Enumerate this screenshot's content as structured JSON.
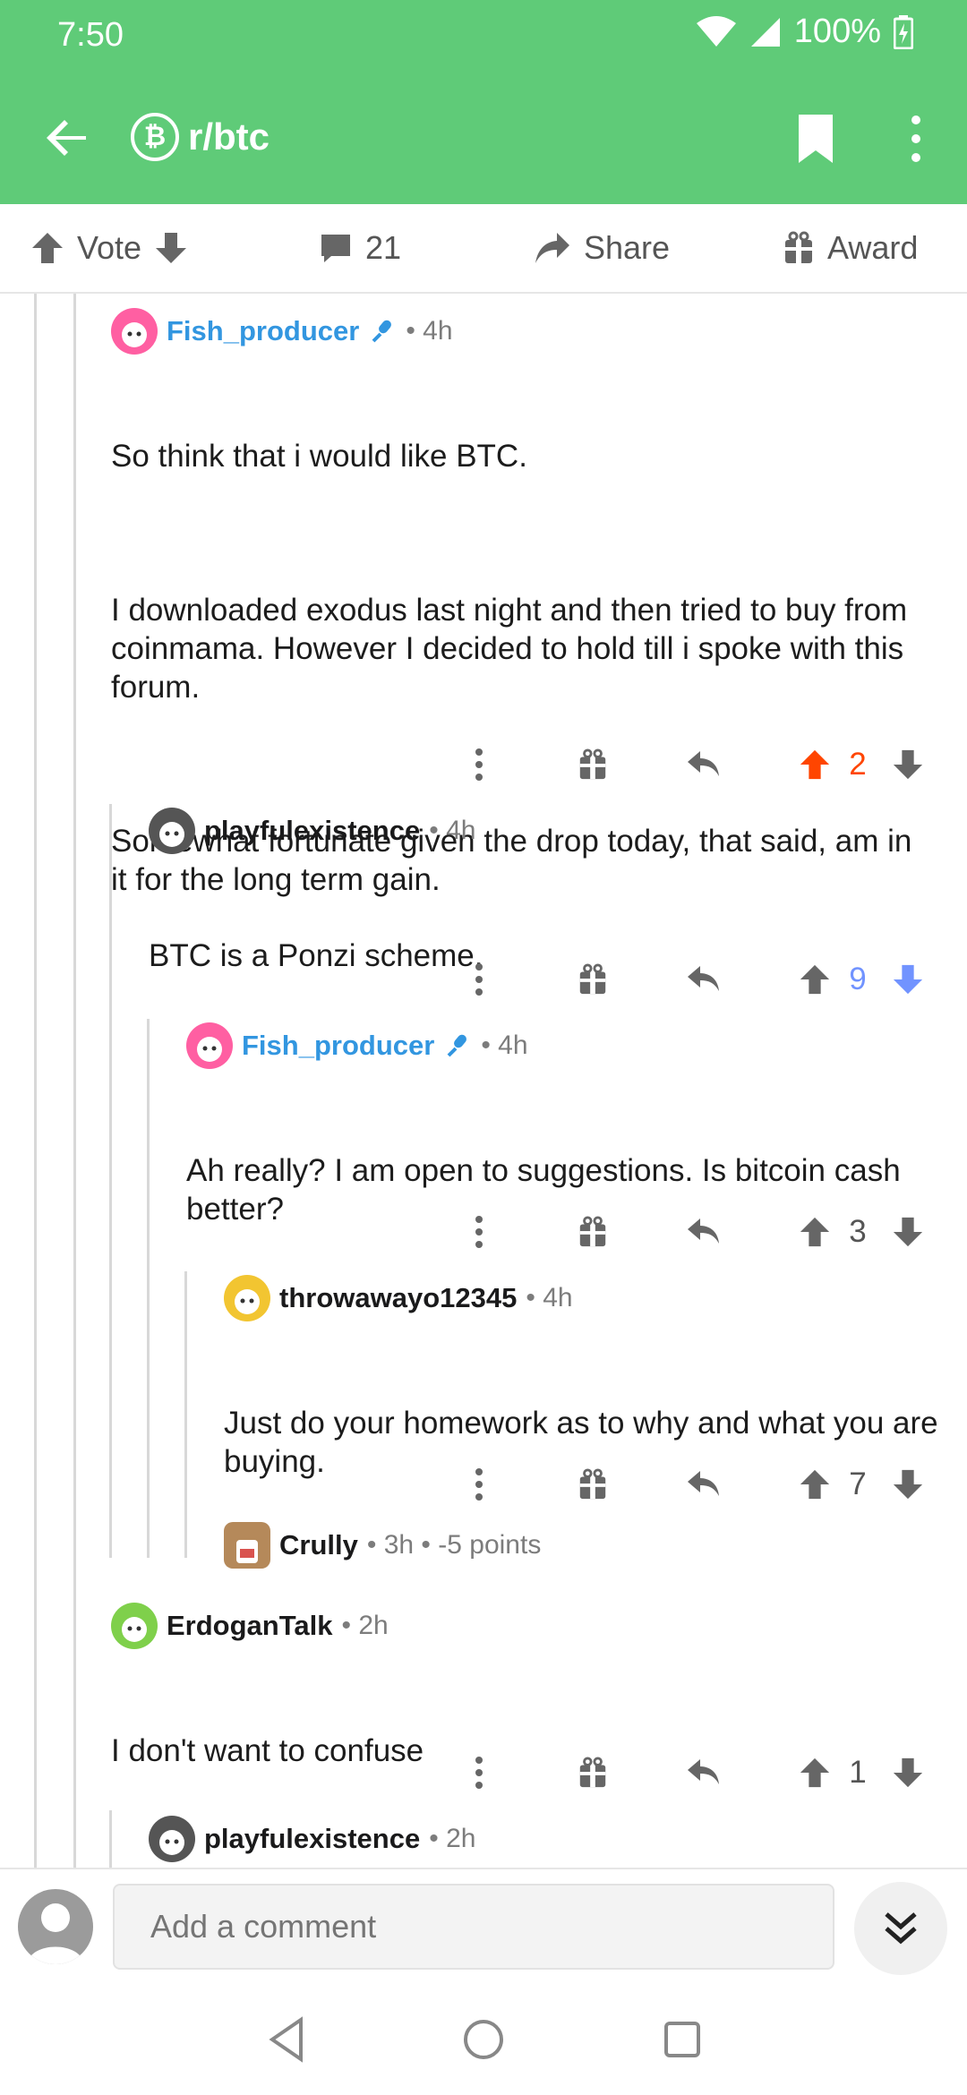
{
  "status_bar": {
    "time": "7:50",
    "battery": "100%"
  },
  "app_bar": {
    "subreddit": "r/btc",
    "subreddit_icon": "bitcoin-icon",
    "back_icon": "arrow-left-icon",
    "bookmark_icon": "bookmark-icon",
    "more_icon": "more-vertical-icon"
  },
  "action_bar": {
    "vote_label": "Vote",
    "comment_count": "21",
    "share_label": "Share",
    "award_label": "Award"
  },
  "comments": [
    {
      "username": "Fish_producer",
      "is_op": true,
      "time": "4h",
      "paragraphs": [
        "So think that i would like BTC.",
        "I downloaded exodus last night and then tried to buy from coinmama. However I decided to hold till i spoke with this forum.",
        "Somewhat fortunate given the drop today, that said, am in it for the long term gain."
      ],
      "score": "2",
      "vote_state": "up",
      "avatar_color": "#ff5fa2"
    },
    {
      "username": "playfulexistence",
      "is_op": false,
      "time": "4h",
      "paragraphs": [
        "BTC is a Ponzi scheme."
      ],
      "score": "9",
      "vote_state": "down",
      "avatar_color": "#555555"
    },
    {
      "username": "Fish_producer",
      "is_op": true,
      "time": "4h",
      "paragraphs": [
        "Ah really? I am open to suggestions. Is bitcoin cash better?"
      ],
      "score": "3",
      "vote_state": "none",
      "avatar_color": "#ff5fa2"
    },
    {
      "username": "throwawayo12345",
      "is_op": false,
      "time": "4h",
      "paragraphs": [
        "Just do your homework as to why and what you are buying."
      ],
      "score": "7",
      "vote_state": "none",
      "avatar_color": "#f2c531"
    },
    {
      "username": "Crully",
      "is_op": false,
      "time": "3h",
      "points": "-5 points",
      "avatar_color": "#b5895a"
    },
    {
      "username": "ErdoganTalk",
      "is_op": false,
      "time": "2h",
      "paragraphs": [
        "I don't want to confuse"
      ],
      "score": "1",
      "vote_state": "none",
      "avatar_color": "#7fd04b"
    },
    {
      "username": "playfulexistence",
      "is_op": false,
      "time": "2h",
      "avatar_color": "#555555"
    }
  ],
  "composer": {
    "placeholder": "Add a comment"
  },
  "colors": {
    "accent": "#5fcb78",
    "upvote": "#ff4500",
    "downvote": "#7193ff",
    "op_name": "#3296e0"
  }
}
